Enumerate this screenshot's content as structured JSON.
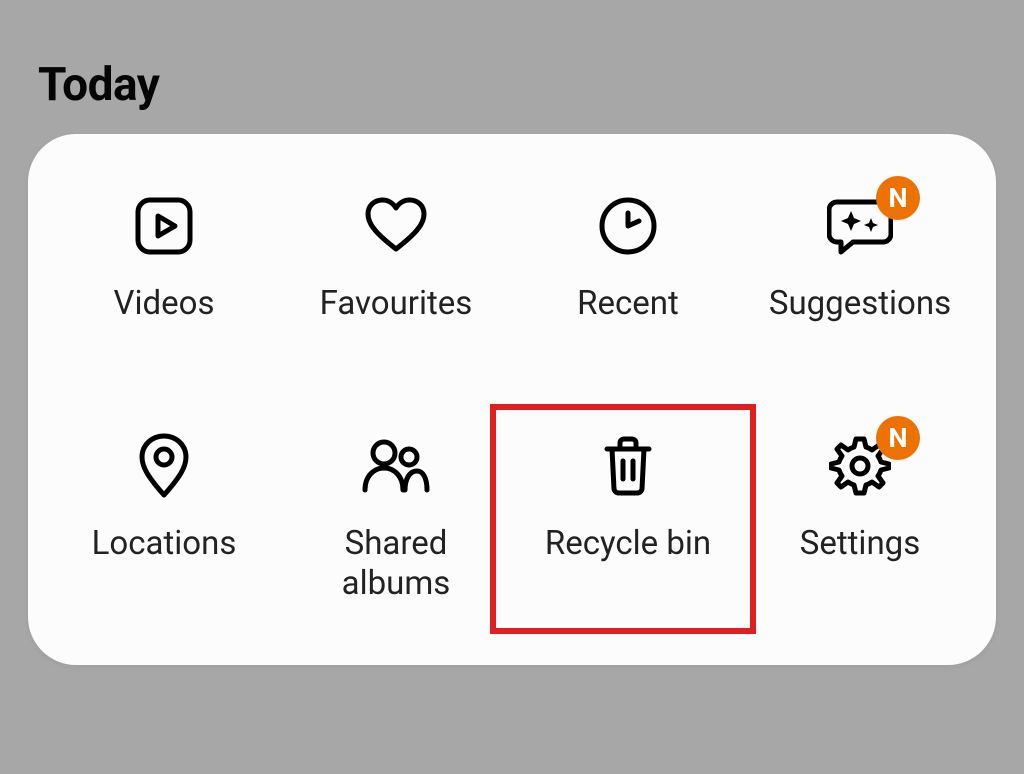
{
  "section_title": "Today",
  "badge_text": "N",
  "colors": {
    "accent": "#ed7203",
    "highlight": "#e02020"
  },
  "items": [
    {
      "key": "videos",
      "label": "Videos",
      "icon": "play-square-icon",
      "badge": false,
      "highlight": false
    },
    {
      "key": "favourites",
      "label": "Favourites",
      "icon": "heart-icon",
      "badge": false,
      "highlight": false
    },
    {
      "key": "recent",
      "label": "Recent",
      "icon": "clock-icon",
      "badge": false,
      "highlight": false
    },
    {
      "key": "suggestions",
      "label": "Suggestions",
      "icon": "sparkle-chat-icon",
      "badge": true,
      "highlight": false
    },
    {
      "key": "locations",
      "label": "Locations",
      "icon": "pin-icon",
      "badge": false,
      "highlight": false
    },
    {
      "key": "shared",
      "label": "Shared\nalbums",
      "icon": "people-icon",
      "badge": false,
      "highlight": false
    },
    {
      "key": "recycle",
      "label": "Recycle bin",
      "icon": "trash-icon",
      "badge": false,
      "highlight": true
    },
    {
      "key": "settings",
      "label": "Settings",
      "icon": "gear-icon",
      "badge": true,
      "highlight": false
    }
  ]
}
